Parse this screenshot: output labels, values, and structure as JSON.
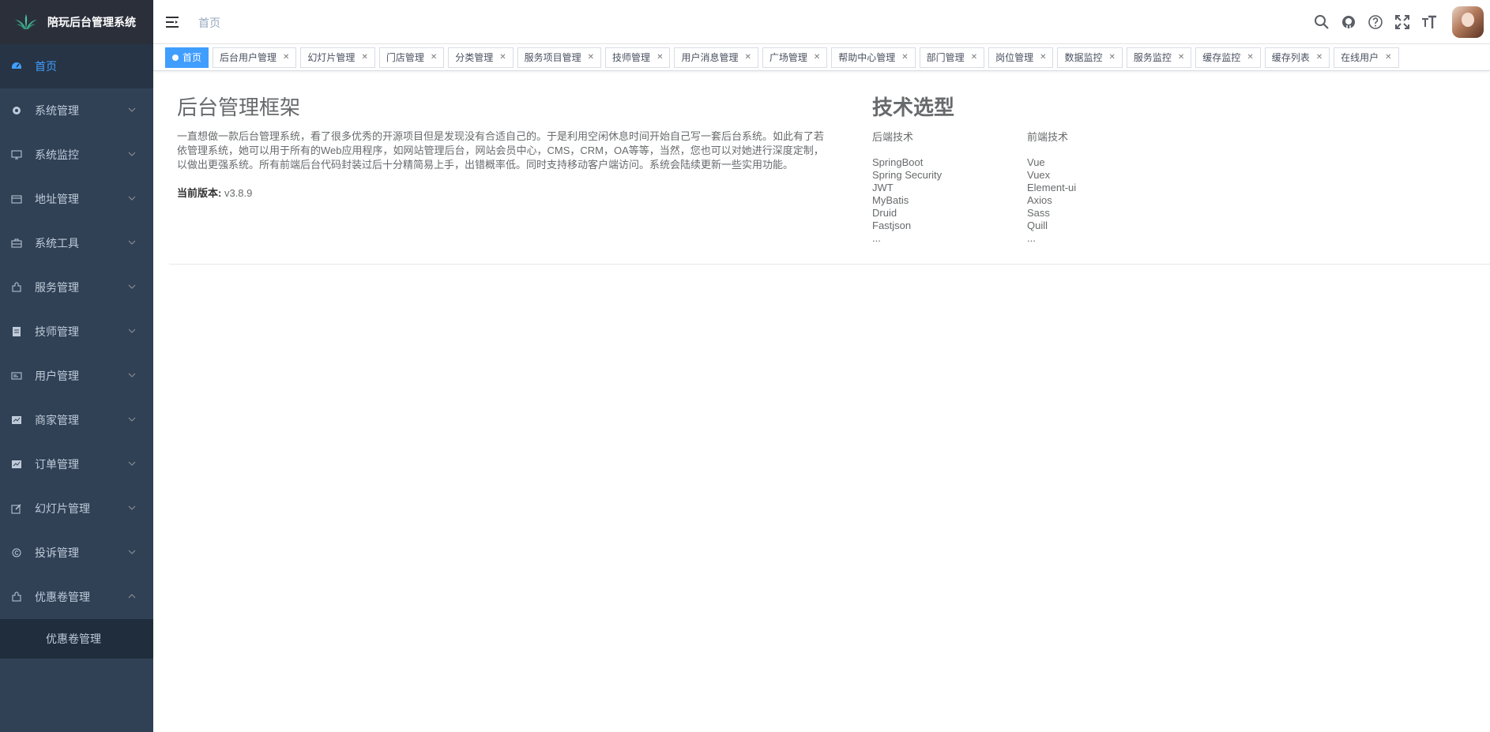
{
  "app": {
    "title": "陪玩后台管理系统"
  },
  "sidebar": {
    "items": [
      {
        "label": "首页",
        "icon": "dashboard-icon"
      },
      {
        "label": "系统管理",
        "icon": "gear-icon"
      },
      {
        "label": "系统监控",
        "icon": "monitor-icon"
      },
      {
        "label": "地址管理",
        "icon": "calendar-icon"
      },
      {
        "label": "系统工具",
        "icon": "toolbox-icon"
      },
      {
        "label": "服务管理",
        "icon": "puzzle-icon"
      },
      {
        "label": "技师管理",
        "icon": "document-icon"
      },
      {
        "label": "用户管理",
        "icon": "card-icon"
      },
      {
        "label": "商家管理",
        "icon": "chart-icon"
      },
      {
        "label": "订单管理",
        "icon": "chart-icon"
      },
      {
        "label": "幻灯片管理",
        "icon": "edit-icon"
      },
      {
        "label": "投诉管理",
        "icon": "copyright-icon"
      },
      {
        "label": "优惠卷管理",
        "icon": "puzzle-icon"
      }
    ],
    "submenu": {
      "label": "优惠卷管理"
    }
  },
  "navbar": {
    "breadcrumb": "首页",
    "icons": [
      "search-icon",
      "github-icon",
      "question-icon",
      "fullscreen-icon",
      "font-size-icon"
    ]
  },
  "tags": [
    {
      "label": "首页",
      "active": true
    },
    {
      "label": "后台用户管理"
    },
    {
      "label": "幻灯片管理"
    },
    {
      "label": "门店管理"
    },
    {
      "label": "分类管理"
    },
    {
      "label": "服务项目管理"
    },
    {
      "label": "技师管理"
    },
    {
      "label": "用户消息管理"
    },
    {
      "label": "广场管理"
    },
    {
      "label": "帮助中心管理"
    },
    {
      "label": "部门管理"
    },
    {
      "label": "岗位管理"
    },
    {
      "label": "数据监控"
    },
    {
      "label": "服务监控"
    },
    {
      "label": "缓存监控"
    },
    {
      "label": "缓存列表"
    },
    {
      "label": "在线用户"
    }
  ],
  "main": {
    "title": "后台管理框架",
    "intro": "一直想做一款后台管理系统，看了很多优秀的开源项目但是发现没有合适自己的。于是利用空闲休息时间开始自己写一套后台系统。如此有了若依管理系统，她可以用于所有的Web应用程序，如网站管理后台，网站会员中心，CMS，CRM，OA等等，当然，您也可以对她进行深度定制，以做出更强系统。所有前端后台代码封装过后十分精简易上手，出错概率低。同时支持移动客户端访问。系统会陆续更新一些实用功能。",
    "version_label": "当前版本:",
    "version_value": "v3.8.9",
    "tech_title": "技术选型",
    "backend_head": "后端技术",
    "backend": [
      "SpringBoot",
      "Spring Security",
      "JWT",
      "MyBatis",
      "Druid",
      "Fastjson",
      "..."
    ],
    "frontend_head": "前端技术",
    "frontend": [
      "Vue",
      "Vuex",
      "Element-ui",
      "Axios",
      "Sass",
      "Quill",
      "..."
    ]
  },
  "colors": {
    "sidebar_bg": "#304156",
    "active_blue": "#409eff"
  }
}
